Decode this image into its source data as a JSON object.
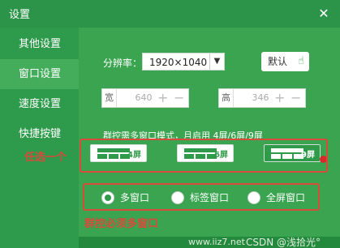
{
  "window": {
    "title": "设置",
    "close_glyph": "✕"
  },
  "sidebar": {
    "items": [
      {
        "label": "其他设置",
        "active": false
      },
      {
        "label": "窗口设置",
        "active": true
      },
      {
        "label": "速度设置",
        "active": false
      },
      {
        "label": "快捷按键",
        "active": false
      }
    ]
  },
  "resolution": {
    "label": "分辨率：",
    "value": "1920×1040",
    "arrow_glyph": "▼",
    "default_label": "默认",
    "default_icon": "hand-pointer-icon",
    "hand_glyph": "☝"
  },
  "dimensions": {
    "width_tag": "宽",
    "width_value": "640",
    "height_tag": "高",
    "height_value": "346",
    "plus": "+",
    "minus": "−"
  },
  "layout": {
    "description": "群控需多窗口模式，月启用 4屏/6屏/9屏",
    "options": [
      {
        "label": "4屏",
        "selected": false
      },
      {
        "label": "6屏",
        "selected": false
      },
      {
        "label": "9屏",
        "selected": true
      }
    ]
  },
  "mode": {
    "options": [
      {
        "label": "多窗口",
        "checked": true
      },
      {
        "label": "标签窗口",
        "checked": false
      },
      {
        "label": "全屏窗口",
        "checked": false
      }
    ]
  },
  "annotations": {
    "choose_one": "任选一个",
    "must_multi": "群控必须多窗口"
  },
  "watermarks": {
    "site": "www.iiz7.net",
    "csdn": "CSDN @浅拾光°"
  },
  "colors": {
    "accent": "#2f9a4a",
    "annotation": "#d84a3a"
  }
}
